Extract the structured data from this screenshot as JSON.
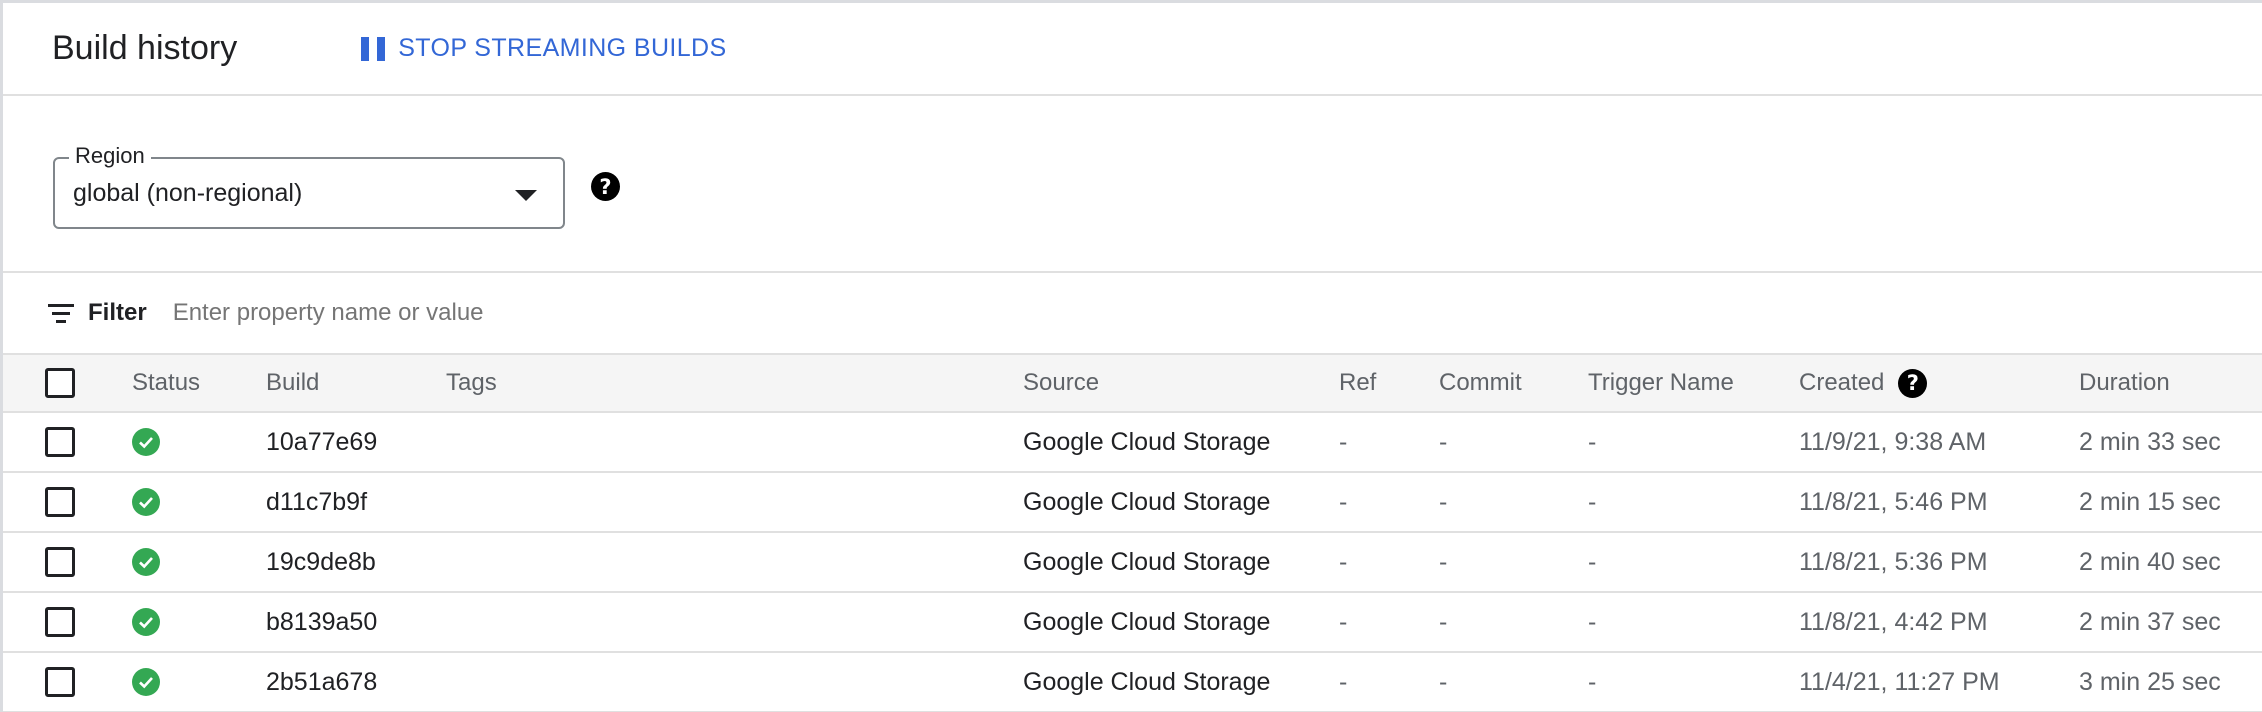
{
  "header": {
    "title": "Build history",
    "stream_button_label": "STOP STREAMING BUILDS"
  },
  "region": {
    "label": "Region",
    "value": "global (non-regional)"
  },
  "filter": {
    "label": "Filter",
    "placeholder": "Enter property name or value"
  },
  "table": {
    "columns": {
      "status": "Status",
      "build": "Build",
      "tags": "Tags",
      "source": "Source",
      "ref": "Ref",
      "commit": "Commit",
      "trigger": "Trigger Name",
      "created": "Created",
      "duration": "Duration"
    },
    "rows": [
      {
        "build": "10a77e69",
        "tags": "",
        "source": "Google Cloud Storage",
        "ref": "-",
        "commit": "-",
        "trigger": "-",
        "created": "11/9/21, 9:38 AM",
        "duration": "2 min 33 sec"
      },
      {
        "build": "d11c7b9f",
        "tags": "",
        "source": "Google Cloud Storage",
        "ref": "-",
        "commit": "-",
        "trigger": "-",
        "created": "11/8/21, 5:46 PM",
        "duration": "2 min 15 sec"
      },
      {
        "build": "19c9de8b",
        "tags": "",
        "source": "Google Cloud Storage",
        "ref": "-",
        "commit": "-",
        "trigger": "-",
        "created": "11/8/21, 5:36 PM",
        "duration": "2 min 40 sec"
      },
      {
        "build": "b8139a50",
        "tags": "",
        "source": "Google Cloud Storage",
        "ref": "-",
        "commit": "-",
        "trigger": "-",
        "created": "11/8/21, 4:42 PM",
        "duration": "2 min 37 sec"
      },
      {
        "build": "2b51a678",
        "tags": "",
        "source": "Google Cloud Storage",
        "ref": "-",
        "commit": "-",
        "trigger": "-",
        "created": "11/4/21, 11:27 PM",
        "duration": "3 min 25 sec"
      }
    ]
  },
  "icons": {
    "stream": "pause-icon",
    "region_dropdown": "caret-down-icon",
    "help": "help-icon",
    "filter": "filter-icon",
    "status_success": "check-circle-icon"
  },
  "colors": {
    "accent": "#3367d6",
    "success": "#34a853"
  }
}
